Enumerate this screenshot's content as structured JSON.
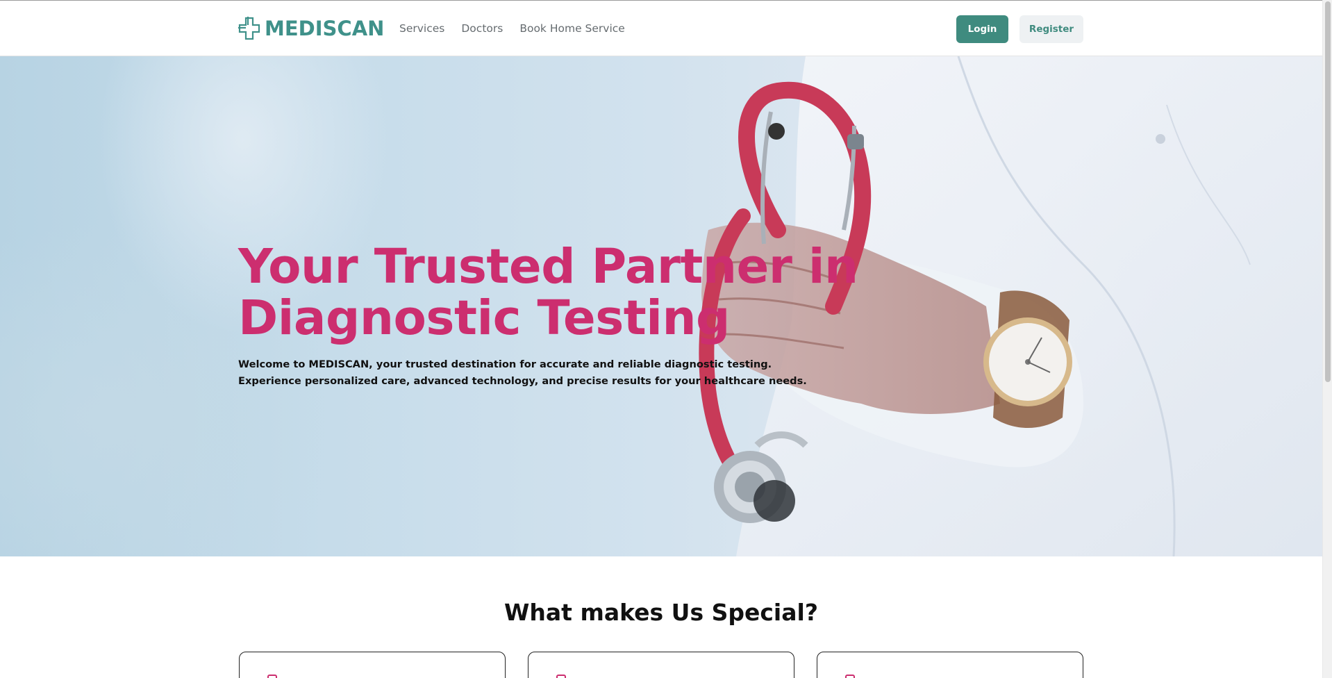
{
  "brand": {
    "name": "MEDISCAN",
    "color": "#3f918a"
  },
  "nav": {
    "links": [
      "Services",
      "Doctors",
      "Book Home Service"
    ],
    "login_label": "Login",
    "register_label": "Register"
  },
  "hero": {
    "title_line1": "Your Trusted Partner in",
    "title_line2": "Diagnostic Testing",
    "description": "Welcome to MEDISCAN, your trusted destination for accurate and reliable diagnostic testing. Experience personalized care, advanced technology, and precise results for your healthcare needs.",
    "title_color": "#cc2e6f"
  },
  "special": {
    "title": "What makes Us Special?",
    "cards": [
      {
        "icon": "feature-icon"
      },
      {
        "icon": "feature-icon"
      },
      {
        "icon": "feature-icon"
      }
    ]
  },
  "colors": {
    "primary": "#3f8b7f",
    "accent": "#cc2e6f",
    "register_bg": "#eef1f3"
  }
}
